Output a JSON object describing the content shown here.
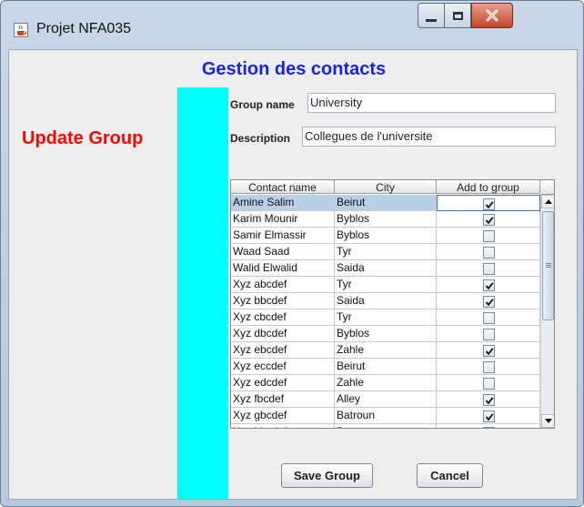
{
  "window": {
    "title": "Projet NFA035"
  },
  "header": {
    "title": "Gestion des contacts"
  },
  "side": {
    "title": "Update Group"
  },
  "form": {
    "group_name_label": "Group name",
    "group_name_value": "University",
    "description_label": "Description",
    "description_value": "Collegues de l'universite"
  },
  "table": {
    "columns": [
      "Contact name",
      "City",
      "Add to group"
    ],
    "rows": [
      {
        "name": "Amine Salim",
        "city": "Beirut",
        "checked": true,
        "selected": true
      },
      {
        "name": "Karim Mounir",
        "city": "Byblos",
        "checked": true
      },
      {
        "name": "Samir Elmassir",
        "city": "Byblos",
        "checked": false
      },
      {
        "name": "Waad Saad",
        "city": "Tyr",
        "checked": false
      },
      {
        "name": "Walid Elwalid",
        "city": "Saida",
        "checked": false
      },
      {
        "name": "Xyz abcdef",
        "city": "Tyr",
        "checked": true
      },
      {
        "name": "Xyz bbcdef",
        "city": "Saida",
        "checked": true
      },
      {
        "name": "Xyz cbcdef",
        "city": "Tyr",
        "checked": false
      },
      {
        "name": "Xyz dbcdef",
        "city": "Byblos",
        "checked": false
      },
      {
        "name": "Xyz ebcdef",
        "city": "Zahle",
        "checked": true
      },
      {
        "name": "Xyz eccdef",
        "city": "Beirut",
        "checked": false
      },
      {
        "name": "Xyz edcdef",
        "city": "Zahle",
        "checked": false
      },
      {
        "name": "Xyz fbcdef",
        "city": "Alley",
        "checked": true
      },
      {
        "name": "Xyz gbcdef",
        "city": "Batroun",
        "checked": true
      },
      {
        "name": "Xyz hbcdef",
        "city": "Batroun",
        "checked": false
      }
    ]
  },
  "buttons": {
    "save": "Save Group",
    "cancel": "Cancel"
  },
  "colors": {
    "title": "#1a22e8",
    "side_title": "#ff0000",
    "accent_bar": "#00ffff",
    "selection": "#b8cfe5"
  }
}
